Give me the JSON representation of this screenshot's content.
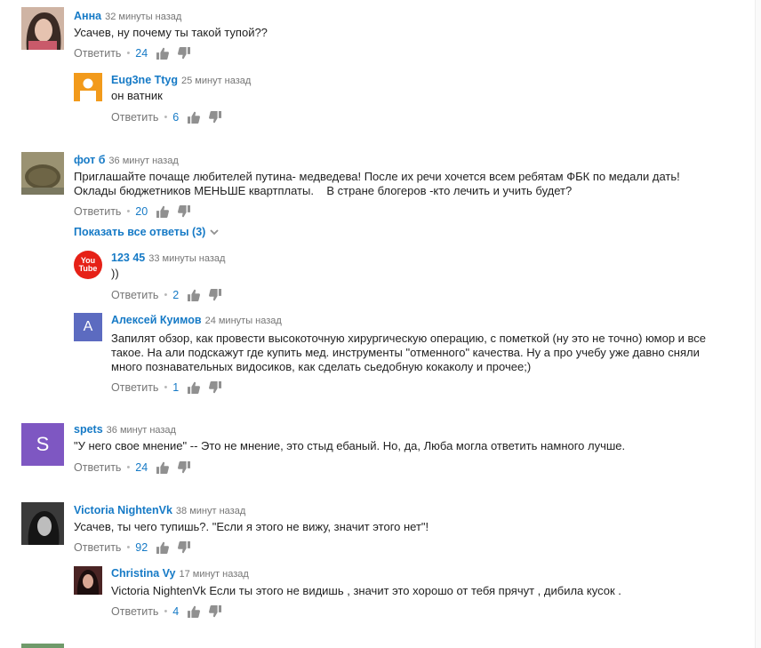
{
  "reply_label": "Ответить",
  "show_all_replies": "Показать все ответы (3)",
  "colors": {
    "link": "#167ac6",
    "meta": "#767676",
    "orange_avatar": "#f29a1b",
    "letter_avatar_a": "#5c6bc0",
    "letter_avatar_s": "#7e57c2",
    "youtube_red": "#e62117"
  },
  "comments": [
    {
      "author": "Анна",
      "time": "32 минуты назад",
      "lines": [
        "Усачев, ну почему ты такой тупой??"
      ],
      "likes": "24"
    },
    {
      "author": "Eug3ne Ttyg",
      "time": "25 минут назад",
      "lines": [
        "он ватник"
      ],
      "likes": "6"
    },
    {
      "author": "фот б",
      "time": "36 минут назад",
      "lines": [
        "Приглашайте почаще любителей путина- медведева! После их речи хочется всем ребятам ФБК по медали дать!",
        "Оклады бюджетников МЕНЬШЕ квартплаты.    В стране блогеров -кто лечить и учить будет?"
      ],
      "likes": "20"
    },
    {
      "author": "123 45",
      "time": "33 минуты назад",
      "lines": [
        "))"
      ],
      "likes": "2",
      "avatar_text": [
        "You",
        "Tube"
      ]
    },
    {
      "author": "Алексей Куимов",
      "time": "24 минуты назад",
      "lines": [
        "Запилят обзор, как провести высокоточную хирургическую операцию, с пометкой (ну это не точно) юмор и все",
        "такое. На али подскажут где купить мед. инструменты \"отменного\" качества. Ну а про учебу уже давно сняли",
        "много познавательных видосиков, как сделать сьедобную кокаколу и прочее;)"
      ],
      "likes": "1",
      "avatar_letter": "A"
    },
    {
      "author": "spets",
      "time": "36 минут назад",
      "lines": [
        "\"У него свое мнение\" -- Это не мнение, это стыд ебаный. Но, да, Люба могла ответить намного лучше."
      ],
      "likes": "24",
      "avatar_letter": "S"
    },
    {
      "author": "Victoria NightenVk",
      "time": "38 минут назад",
      "lines": [
        "Усачев, ты чего тупишь?. \"Если я этого не вижу, значит этого нет\"!"
      ],
      "likes": "92"
    },
    {
      "author": "Christina Vy",
      "time": "17 минут назад",
      "lines": [
        "Victoria NightenVk Если ты этого не видишь , значит это хорошо от тебя прячут , дибила кусок ."
      ],
      "likes": "4"
    }
  ]
}
